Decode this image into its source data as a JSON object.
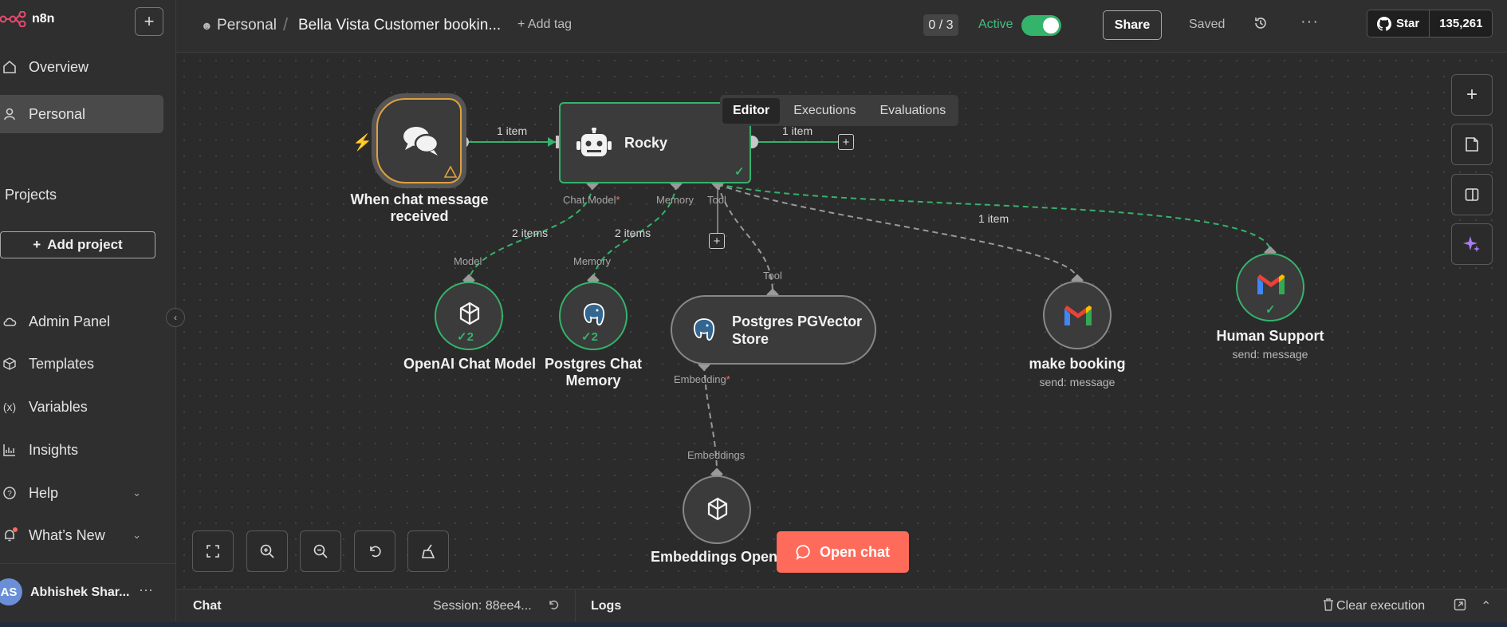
{
  "app": {
    "logo_text": "n8n"
  },
  "sidebar": {
    "nav_top": [
      {
        "label": "Overview",
        "icon": "home-icon"
      },
      {
        "label": "Personal",
        "icon": "user-icon"
      }
    ],
    "projects_title": "Projects",
    "add_project_label": "Add project",
    "nav_bottom": [
      {
        "label": "Admin Panel",
        "icon": "cloud-icon"
      },
      {
        "label": "Templates",
        "icon": "box-icon"
      },
      {
        "label": "Variables",
        "icon": "variables-icon"
      },
      {
        "label": "Insights",
        "icon": "chart-icon"
      },
      {
        "label": "Help",
        "icon": "help-icon"
      },
      {
        "label": "What’s New",
        "icon": "bell-icon"
      }
    ],
    "user": {
      "initials": "AS",
      "name": "Abhishek Shar..."
    }
  },
  "header": {
    "breadcrumb_project": "Personal",
    "workflow_name": "Bella Vista Customer bookin...",
    "add_tag": "+ Add tag",
    "counter": "0 / 3",
    "active_label": "Active",
    "share_label": "Share",
    "saved_label": "Saved",
    "github_star": "Star",
    "github_count": "135,261"
  },
  "tabs": [
    "Editor",
    "Executions",
    "Evaluations"
  ],
  "nodes": {
    "trigger": {
      "label_line1": "When chat message",
      "label_line2": "received"
    },
    "agent": {
      "title": "Rocky",
      "ports": {
        "chat_model": "Chat Model",
        "memory": "Memory",
        "tool": "Tool"
      }
    },
    "openai_chat": {
      "label": "OpenAI Chat Model",
      "port": "Model",
      "count": "2"
    },
    "pg_memory": {
      "label_line1": "Postgres Chat",
      "label_line2": "Memory",
      "port": "Memory",
      "count": "2"
    },
    "pgvector": {
      "title_line1": "Postgres PGVector",
      "title_line2": "Store",
      "port_top": "Tool",
      "port_bottom": "Embedding"
    },
    "embeddings": {
      "label": "Embeddings OpenA",
      "port": "Embeddings"
    },
    "make_booking": {
      "label": "make booking",
      "sub": "send: message"
    },
    "human_support": {
      "label": "Human Support",
      "sub": "send: message"
    }
  },
  "edge_labels": {
    "trigger_agent": "1 item",
    "agent_out": "1 item",
    "chat_model": "2 items",
    "memory": "2 items",
    "human_support": "1 item"
  },
  "open_chat_label": "Open chat",
  "footer": {
    "chat_label": "Chat",
    "session": "Session: 88ee4...",
    "logs_label": "Logs",
    "clear_label": "Clear execution"
  },
  "colors": {
    "accent_green": "#34b36b",
    "trigger_orange": "#e0a040",
    "open_chat": "#ff6b5b"
  }
}
